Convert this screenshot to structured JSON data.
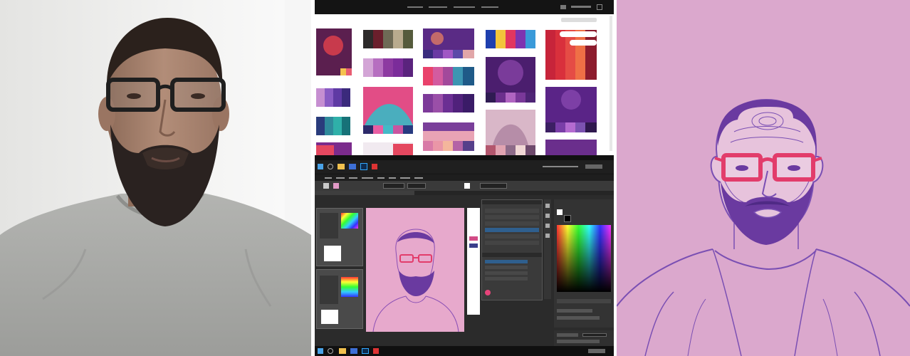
{
  "colors": {
    "right_background": "#dba8cd",
    "portrait_purple": "#6a3aa0",
    "portrait_line": "#7a4fb3",
    "glasses_red": "#e23c6b",
    "app_dark": "#2b2b2b",
    "shirt_grey": "#a9aaa7"
  },
  "icons": [
    "windows-start-icon",
    "taskbar-search-icon",
    "file-explorer-icon",
    "photoshop-icon",
    "palette-swatch-icon"
  ],
  "palette_site": {
    "nav": [
      "",
      "",
      "",
      ""
    ],
    "status_note": ""
  },
  "editor": {
    "menu_items": [
      "",
      "",
      "",
      "",
      "",
      "",
      "",
      ""
    ],
    "panels": [
      "",
      ""
    ]
  }
}
